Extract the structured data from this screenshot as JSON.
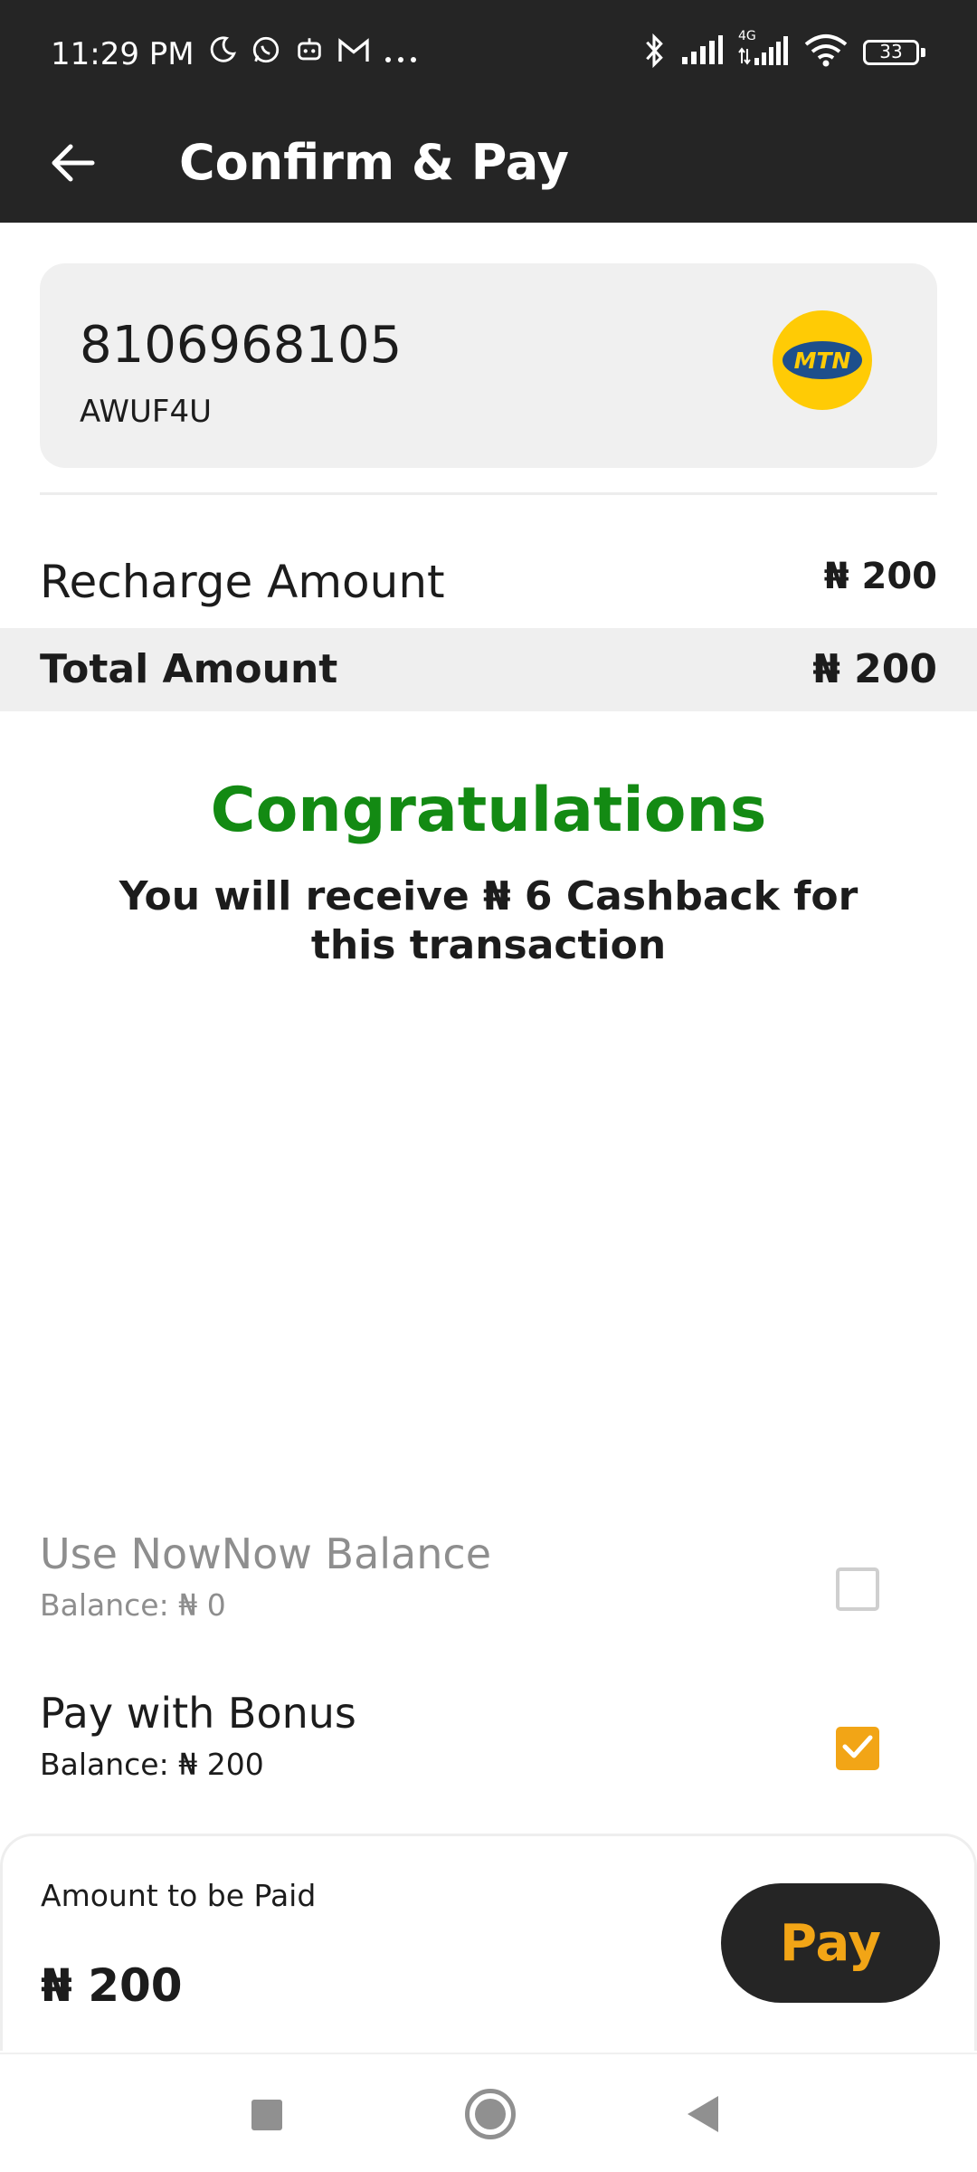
{
  "status_bar": {
    "time": "11:29 PM",
    "battery": "33",
    "network": "4G",
    "left_icons": [
      "moon-icon",
      "whatsapp-icon",
      "bot-icon",
      "gmail-icon",
      "more-dots-icon"
    ],
    "right_icons": [
      "bluetooth-icon",
      "signal-icon",
      "signal-4g-icon",
      "wifi-icon",
      "battery-icon"
    ]
  },
  "app_bar": {
    "title": "Confirm & Pay",
    "back_icon": "arrow-left-icon"
  },
  "number_card": {
    "phone_number": "8106968105",
    "plan": "AWUF4U",
    "operator_logo_text": "MTN",
    "colors": {
      "logo_bg": "#ffcb05",
      "logo_oval": "#1d4f8c"
    }
  },
  "amounts": {
    "recharge_label": "Recharge Amount",
    "recharge_value": "₦ 200",
    "total_label": "Total Amount",
    "total_value": "₦ 200"
  },
  "congrats": {
    "title": "Congratulations",
    "message": "You will receive ₦ 6 Cashback for this transaction",
    "color": "#138a13"
  },
  "payment_options": [
    {
      "title": "Use NowNow Balance",
      "balance": "Balance: ₦ 0",
      "checked": false
    },
    {
      "title": "Pay with Bonus",
      "balance": "Balance: ₦ 200",
      "checked": true
    }
  ],
  "pay_panel": {
    "caption": "Amount to be Paid",
    "amount": "₦ 200",
    "button_label": "Pay",
    "colors": {
      "button_bg": "#252525",
      "button_text": "#f2a516"
    }
  },
  "nav_bar": {
    "icons": [
      "recent-apps-icon",
      "home-icon",
      "back-triangle-icon"
    ]
  }
}
